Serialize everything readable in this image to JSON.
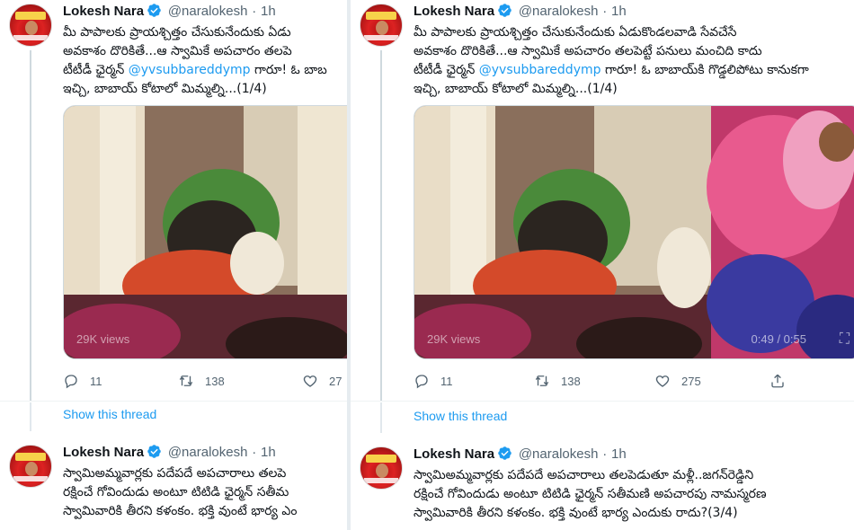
{
  "author": {
    "name": "Lokesh Nara",
    "handle": "@naralokesh",
    "separator": "·",
    "time": "1h"
  },
  "left_panel": {
    "tweet1": {
      "line1": "మీ పాపాలకు ప్రాయశ్చిత్తం చేసుకునేందుకు ఏడు",
      "line2": "అవకాశం దొరికితే...ఆ స్వామికే అపచారం తలపె",
      "line3_prefix": "టీటీడీ ఛైర్మన్ ",
      "line3_link": "@yvsubbareddymp",
      "line3_suffix": " గారూ! ఓ బాబ",
      "line4": "ఇచ్చి, బాబాయ్ కోటాలో మిమ్మల్ని...(1/4)",
      "media_views": "29K views",
      "replies": "11",
      "retweets": "138",
      "likes": "27"
    },
    "show_thread": "Show this thread",
    "tweet2": {
      "line1": "స్వామిఅమ్మవార్లకు పదేపదే అపచారాలు తలపె",
      "line2": "రక్షించే గోవిందుడు అంటూ టిటిడి ఛైర్మన్ సతీమ",
      "line3": "స్వామివారికి తీరని కళంకం. భక్తి వుంటే భార్య ఎం"
    }
  },
  "right_panel": {
    "tweet1": {
      "line1": "మీ పాపాలకు ప్రాయశ్చిత్తం చేసుకునేందుకు ఏడుకొండలవాడి సేవచేసే",
      "line2": "అవకాశం దొరికితే...ఆ స్వామికే అపచారం తలపెట్టే పనులు మంచిది కాదు",
      "line3_prefix": "టీటీడీ ఛైర్మన్ ",
      "line3_link": "@yvsubbareddymp",
      "line3_suffix": " గారూ! ఓ బాబాయ్‌కి గొడ్డలిపోటు కానుకగా",
      "line4": "ఇచ్చి, బాబాయ్ కోటాలో మిమ్మల్ని...(1/4)",
      "media_views": "29K views",
      "media_time": "0:49 / 0:55",
      "replies": "11",
      "retweets": "138",
      "likes": "275"
    },
    "show_thread": "Show this thread",
    "tweet2": {
      "line1": "స్వామిఅమ్మవార్లకు పదేపదే అపచారాలు తలపెడుతూ మళ్లీ..జగన్‌రెడ్డిని",
      "line2": "రక్షించే గోవిందుడు అంటూ టిటిడి ఛైర్మన్ సతీమణి అపచారపు నామస్మరణ",
      "line3": "స్వామివారికి తీరని కళంకం. భక్తి వుంటే భార్య ఎందుకు రాదు?(3/4)"
    }
  },
  "colors": {
    "link": "#1d9bf0",
    "verified": "#1d9bf0",
    "muted": "#536471"
  },
  "icons": [
    "verified-badge-icon",
    "reply-icon",
    "retweet-icon",
    "like-icon",
    "share-icon",
    "fullscreen-icon"
  ]
}
